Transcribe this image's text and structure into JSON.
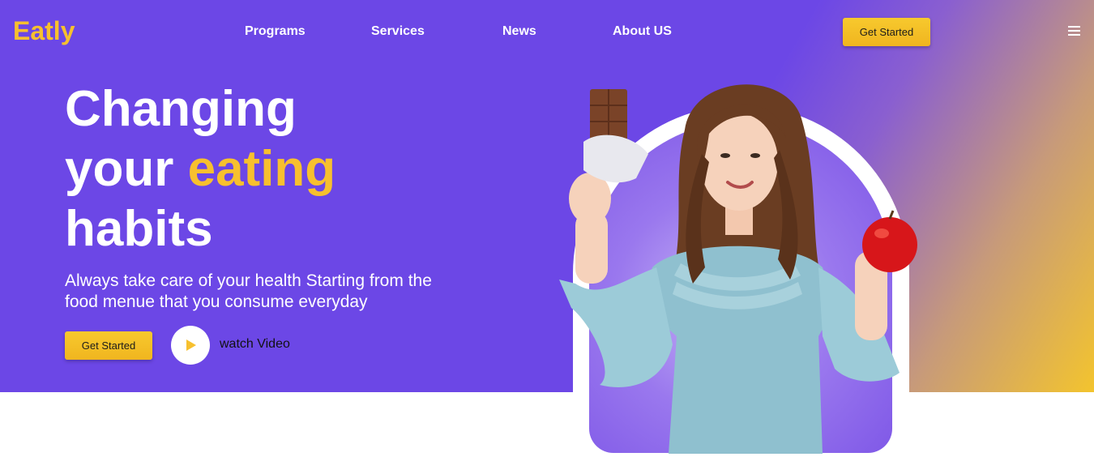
{
  "brand": {
    "name": "Eatly"
  },
  "nav": {
    "items": [
      {
        "label": "Programs"
      },
      {
        "label": "Services"
      },
      {
        "label": "News"
      },
      {
        "label": "About US"
      }
    ],
    "cta_label": "Get Started"
  },
  "hero": {
    "headline_1": "Changing",
    "headline_2a": "your ",
    "headline_2b": "eating",
    "headline_3": "habits",
    "subtext": "Always take care of your health Starting from the food menue that you consume everyday",
    "cta_label": "Get Started",
    "video_label": "watch Video"
  },
  "colors": {
    "primary": "#6c47e6",
    "accent": "#f7c02e",
    "white": "#ffffff"
  },
  "icons": {
    "menu": "hamburger-icon",
    "play": "play-icon"
  }
}
